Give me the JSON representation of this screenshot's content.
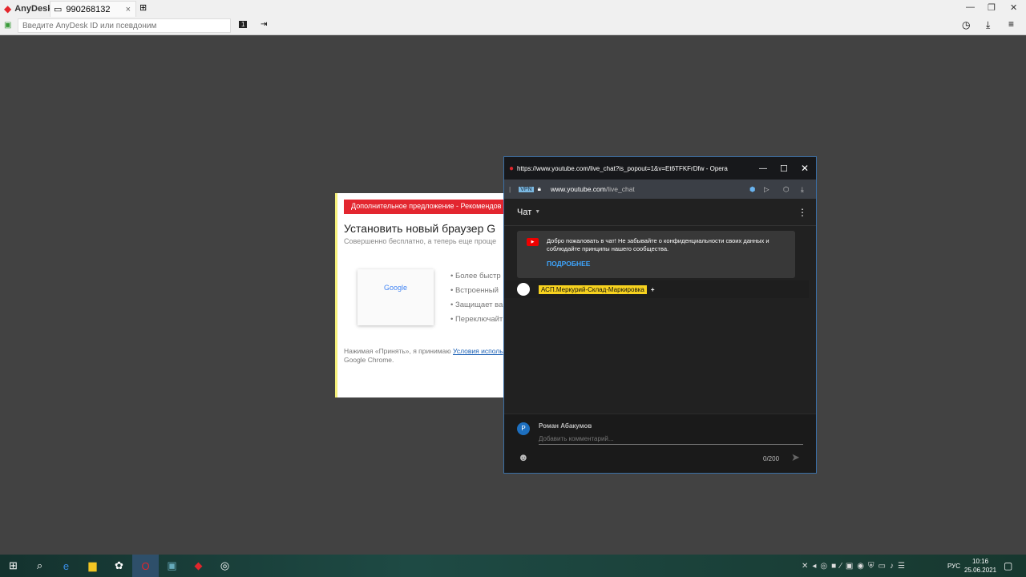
{
  "anydesk": {
    "brand": "AnyDesk",
    "tab_label": "990268132",
    "id_placeholder": "Введите AnyDesk ID или псевдоним",
    "monitor_badge": "1"
  },
  "offer": {
    "banner": "Дополнительное предложение - Рекомендов",
    "title": "Установить новый браузер G",
    "subtitle": "Совершенно бесплатно, а теперь еще проще",
    "bullets": [
      "• Более быстр",
      "• Встроенный",
      "• Защищает ва",
      "• Переключайт"
    ],
    "legal_prefix": "Нажимая «Принять», я принимаю ",
    "legal_link": "Условия исполь",
    "legal_suffix": "Google Chrome.",
    "logo": "Google"
  },
  "opera": {
    "title": "https://www.youtube.com/live_chat?is_popout=1&v=Et6TFKFrDfw - Opera",
    "vpn": "VPN",
    "url_host": "www.youtube.com",
    "url_path": "/live_chat"
  },
  "chat": {
    "header": "Чат",
    "welcome": "Добро пожаловать в чат! Не забывайте о конфиденциальности своих данных и соблюдайте принципы нашего сообщества.",
    "more": "ПОДРОБНЕЕ",
    "channel": "АСП.Меркурий-Склад-Маркировка",
    "plus": "+",
    "user": "Роман Абакумов",
    "avatar_letter": "Р",
    "placeholder": "Добавить комментарий...",
    "counter": "0/200"
  },
  "taskbar": {
    "lang": "РУС",
    "time": "10:16",
    "date": "25.06.2021"
  }
}
